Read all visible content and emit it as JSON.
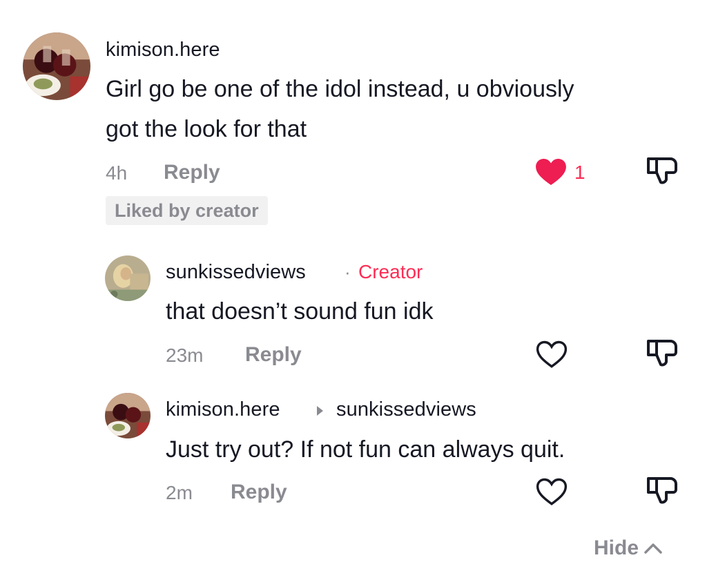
{
  "comments": [
    {
      "username": "kimison.here",
      "text": "Girl go be one of the idol instead, u obviously got the look for that",
      "time": "4h",
      "reply_label": "Reply",
      "like_count": "1",
      "liked": true,
      "badge": "Liked by creator"
    }
  ],
  "replies": [
    {
      "username": "sunkissedviews",
      "separator": "·",
      "role_tag": "Creator",
      "text": "that doesn’t sound fun idk",
      "time": "23m",
      "reply_label": "Reply",
      "liked": false
    },
    {
      "username": "kimison.here",
      "reply_to": "sunkissedviews",
      "text": "Just try out? If not fun can always quit.",
      "time": "2m",
      "reply_label": "Reply",
      "liked": false
    }
  ],
  "footer": {
    "hide_label": "Hide"
  },
  "colors": {
    "like_red": "#fe2c55",
    "secondary_text": "#8a8b91",
    "primary_text": "#161823",
    "badge_bg": "#f1f1f2"
  },
  "icons": {
    "like": "heart-icon",
    "dislike": "thumbs-down-icon",
    "collapse": "chevron-up-icon"
  }
}
